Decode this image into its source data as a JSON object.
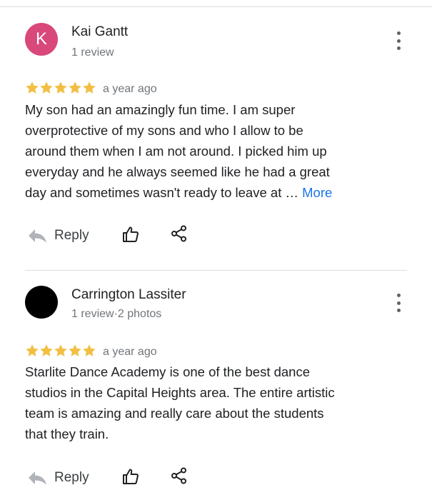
{
  "reviews": [
    {
      "avatar_letter": "K",
      "avatar_color": "#d9487a",
      "name": "Kai Gantt",
      "meta": "1 review",
      "rating": 5,
      "date": "a year ago",
      "text_lines": [
        "My son had an amazingly fun time.  I am super",
        "overprotective of my sons and who I allow to be",
        "around them when I am not around.  I picked him up",
        "everyday and he always seemed like he had a great",
        "day and sometimes wasn't ready to leave at …"
      ],
      "more_label": "More",
      "reply_label": "Reply"
    },
    {
      "avatar_letter": "",
      "avatar_color": "#000000",
      "name": "Carrington Lassiter",
      "meta": "1 review·2 photos",
      "rating": 5,
      "date": "a year ago",
      "text_lines": [
        "Starlite Dance Academy is one of the best dance",
        "studios in the Capital Heights area. The entire artistic",
        "team is amazing and really care about the students",
        "that they train."
      ],
      "reply_label": "Reply"
    }
  ],
  "colors": {
    "star": "#f1bf42",
    "link": "#1a73e8",
    "icon": "#202124",
    "reply_icon": "#b0b3b8"
  },
  "icons": {
    "reply": "reply-arrow-icon",
    "like": "thumbs-up-icon",
    "share": "share-icon",
    "more": "more-vertical-icon",
    "star": "star-icon"
  }
}
